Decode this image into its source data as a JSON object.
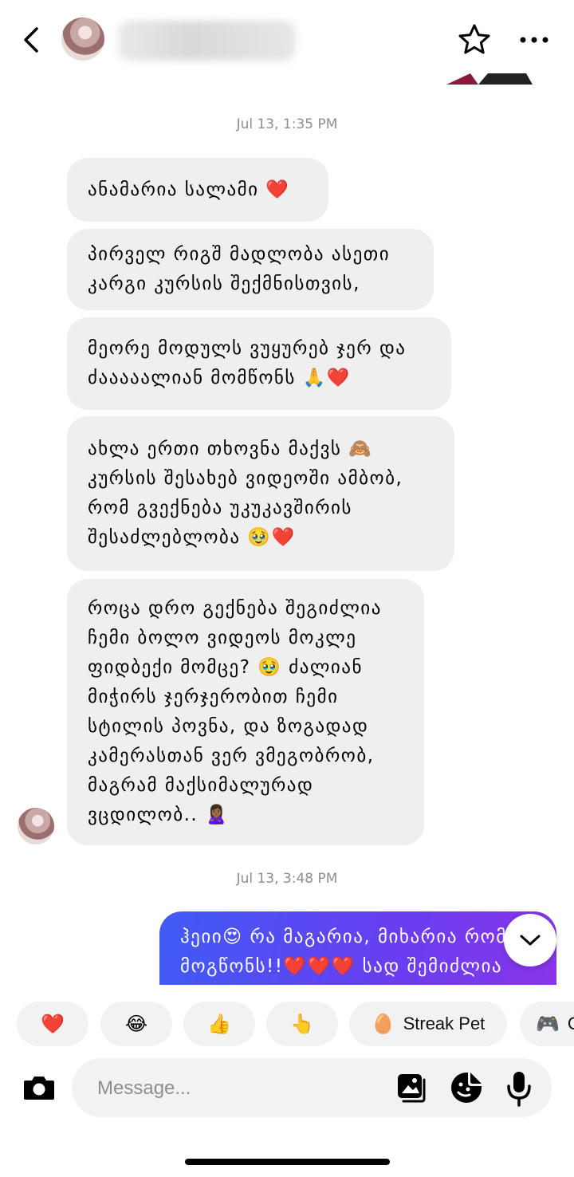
{
  "header": {
    "avatar": "contact-avatar",
    "contact_name": "",
    "icons": [
      "chevron-left-icon",
      "star-icon",
      "more-icon"
    ]
  },
  "thread": {
    "timestamp_1": "Jul 13, 1:35 PM",
    "incoming": [
      {
        "lines": [
          "ანამარია სალამი ❤️"
        ]
      },
      {
        "lines": [
          "პირველ რიგშ მადლობა ასეთი",
          "კარგი კურსის შექმნისთვის,"
        ]
      },
      {
        "lines": [
          "მეორე მოდულს ვუყურებ ჯერ და",
          "ძააააალიან მომწონს 🙏❤️"
        ]
      },
      {
        "lines": [
          "ახლა ერთი თხოვნა მაქვს 🙈",
          "კურსის შესახებ ვიდეოში ამბობ,",
          "რომ გვექნება უკუკავშირის",
          "შესაძლებლობა 🥹❤️"
        ]
      },
      {
        "lines": [
          "როცა დრო გექნება შეგიძლია",
          "ჩემი ბოლო ვიდეოს მოკლე",
          "ფიდბექი მომცე? 🥹 ძალიან",
          "მიჭირს ჯერჯერობით ჩემი",
          "სტილის პოვნა, და ზოგადად",
          "კამერასთან ვერ ვმეგობრობ,",
          "მაგრამ მაქსიმალურად",
          "ვცდილობ.. 🙎🏾‍♀️"
        ]
      }
    ],
    "timestamp_2": "Jul 13, 3:48 PM",
    "outgoing": {
      "lines": [
        "ჰეიი😍 რა მაგარია, მიხარია რომ",
        "მოგწონს!!❤️❤️❤️ სად შემიძლია"
      ]
    }
  },
  "reactions": [
    {
      "emoji": "❤️",
      "label": ""
    },
    {
      "emoji": "😂",
      "label": ""
    },
    {
      "emoji": "👍",
      "label": ""
    },
    {
      "emoji": "👆",
      "label": ""
    },
    {
      "emoji": "🥚",
      "label": "Streak Pet"
    },
    {
      "emoji": "🎮",
      "label": "G"
    }
  ],
  "composer": {
    "placeholder": "Message...",
    "icons": [
      "camera-icon",
      "gallery-icon",
      "sticker-icon",
      "microphone-icon"
    ]
  },
  "colors": {
    "incoming_bubble": "#efefef",
    "outgoing_gradient_start": "#3f5bf6",
    "outgoing_gradient_end": "#8a35e8",
    "timestamp": "#8e8e8e"
  }
}
